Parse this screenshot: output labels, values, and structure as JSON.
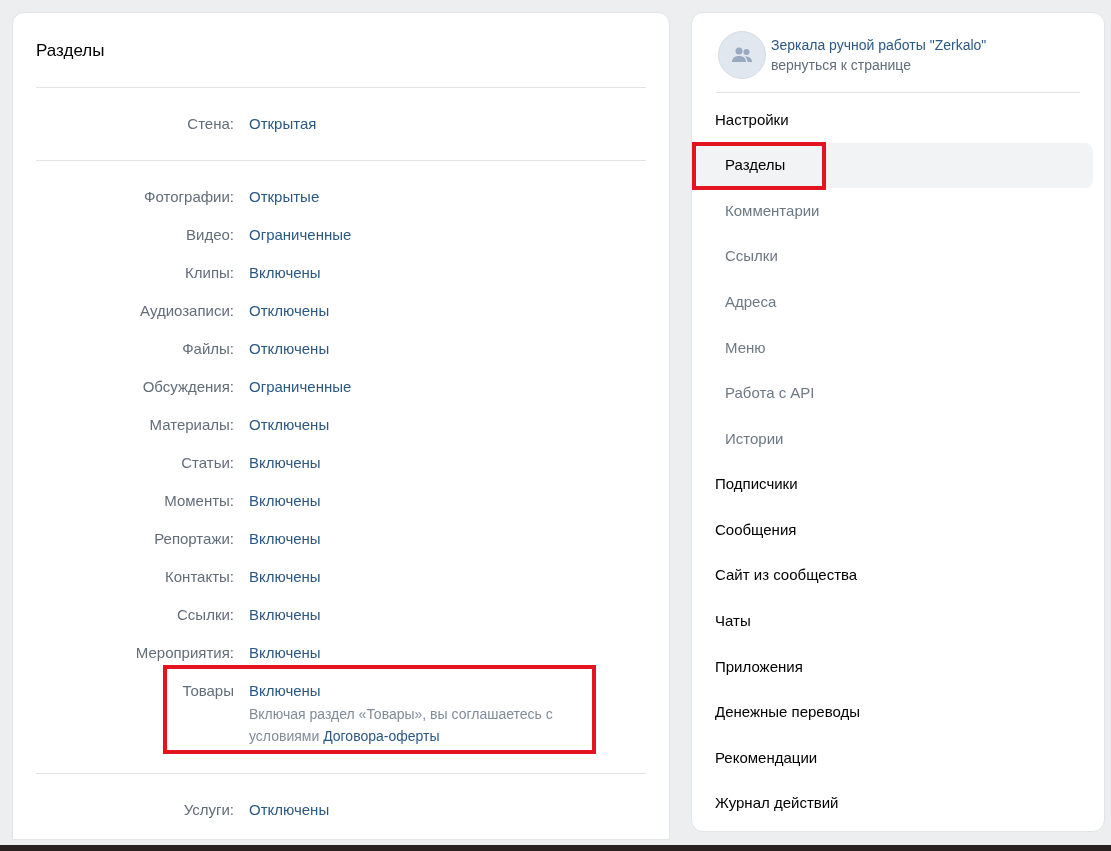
{
  "sections_panel": {
    "title": "Разделы",
    "groups": [
      {
        "rows": [
          {
            "label": "Стена:",
            "value": "Открытая",
            "highlighted": false
          }
        ]
      },
      {
        "rows": [
          {
            "label": "Фотографии:",
            "value": "Открытые",
            "highlighted": false
          },
          {
            "label": "Видео:",
            "value": "Ограниченные",
            "highlighted": false
          },
          {
            "label": "Клипы:",
            "value": "Включены",
            "highlighted": false
          },
          {
            "label": "Аудиозаписи:",
            "value": "Отключены",
            "highlighted": false
          },
          {
            "label": "Файлы:",
            "value": "Отключены",
            "highlighted": false
          },
          {
            "label": "Обсуждения:",
            "value": "Ограниченные",
            "highlighted": false
          },
          {
            "label": "Материалы:",
            "value": "Отключены",
            "highlighted": false
          },
          {
            "label": "Статьи:",
            "value": "Включены",
            "highlighted": false
          },
          {
            "label": "Моменты:",
            "value": "Включены",
            "highlighted": false
          },
          {
            "label": "Репортажи:",
            "value": "Включены",
            "highlighted": false
          },
          {
            "label": "Контакты:",
            "value": "Включены",
            "highlighted": false
          },
          {
            "label": "Ссылки:",
            "value": "Включены",
            "highlighted": false
          },
          {
            "label": "Мероприятия:",
            "value": "Включены",
            "highlighted": false
          },
          {
            "label": "Товары",
            "value": "Включены",
            "highlighted": true,
            "note": {
              "text": "Включая раздел «Товары», вы соглашаетесь с условиями",
              "link": "Договора-оферты"
            }
          }
        ]
      },
      {
        "rows": [
          {
            "label": "Услуги:",
            "value": "Отключены",
            "highlighted": false
          }
        ]
      }
    ]
  },
  "sidebar": {
    "community": {
      "name": "Зеркала ручной работы \"Zerkalo\"",
      "back_link": "вернуться к странице"
    },
    "items": [
      {
        "label": "Настройки",
        "selected": false,
        "highlighted": false,
        "children": [
          {
            "label": "Разделы",
            "selected": true,
            "highlighted": true
          },
          {
            "label": "Комментарии",
            "selected": false,
            "highlighted": false
          },
          {
            "label": "Ссылки",
            "selected": false,
            "highlighted": false
          },
          {
            "label": "Адреса",
            "selected": false,
            "highlighted": false
          },
          {
            "label": "Меню",
            "selected": false,
            "highlighted": false
          },
          {
            "label": "Работа с API",
            "selected": false,
            "highlighted": false
          },
          {
            "label": "Истории",
            "selected": false,
            "highlighted": false
          }
        ]
      },
      {
        "label": "Подписчики",
        "selected": false,
        "highlighted": false
      },
      {
        "label": "Сообщения",
        "selected": false,
        "highlighted": false
      },
      {
        "label": "Сайт из сообщества",
        "selected": false,
        "highlighted": false
      },
      {
        "label": "Чаты",
        "selected": false,
        "highlighted": false
      },
      {
        "label": "Приложения",
        "selected": false,
        "highlighted": false
      },
      {
        "label": "Денежные переводы",
        "selected": false,
        "highlighted": false
      },
      {
        "label": "Рекомендации",
        "selected": false,
        "highlighted": false
      },
      {
        "label": "Журнал действий",
        "selected": false,
        "highlighted": false
      }
    ]
  }
}
